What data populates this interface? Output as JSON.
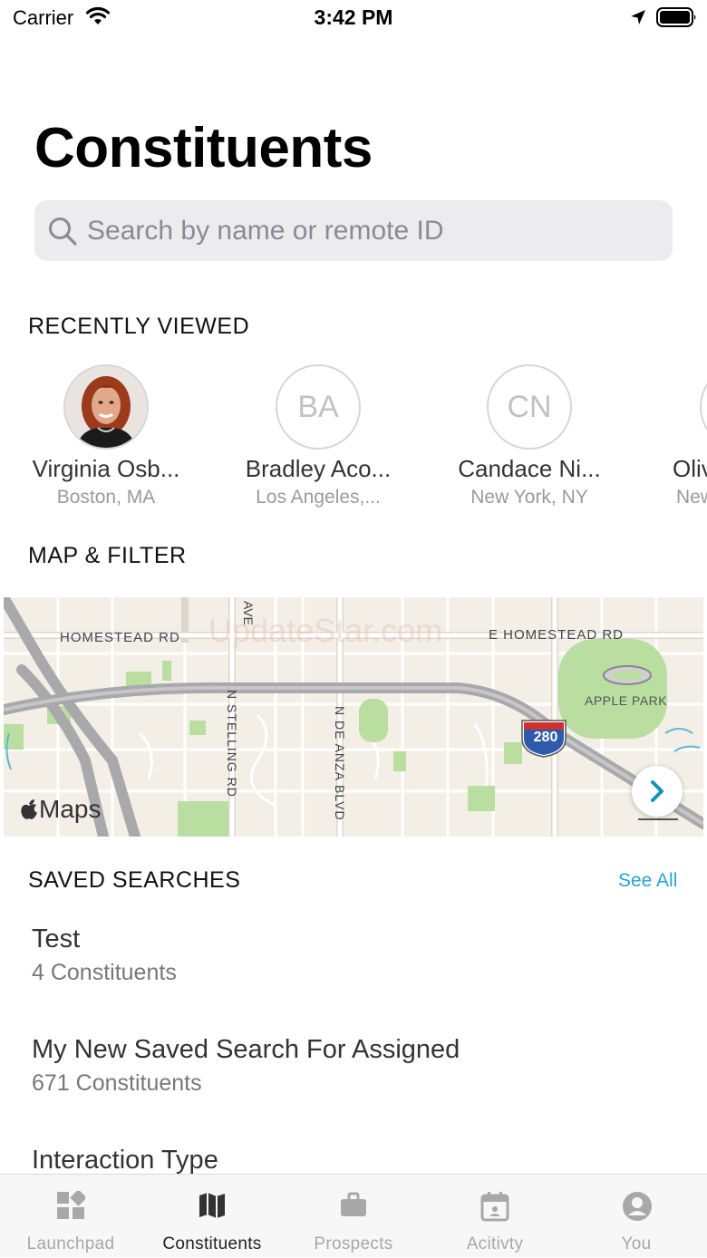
{
  "status_bar": {
    "carrier": "Carrier",
    "time": "3:42 PM",
    "icons": [
      "wifi-icon",
      "location-arrow-icon",
      "battery-icon"
    ]
  },
  "page": {
    "title": "Constituents"
  },
  "search": {
    "placeholder": "Search by name or remote ID",
    "value": "",
    "icon": "search-icon"
  },
  "recently_viewed": {
    "header": "RECENTLY VIEWED",
    "items": [
      {
        "initials": "",
        "name": "Virginia Osb...",
        "location": "Boston, MA",
        "has_photo": true
      },
      {
        "initials": "BA",
        "name": "Bradley Aco...",
        "location": "Los Angeles,..."
      },
      {
        "initials": "CN",
        "name": "Candace Ni...",
        "location": "New York, NY"
      },
      {
        "initials": "",
        "name": "Oliv",
        "location": "New"
      }
    ]
  },
  "map_filter": {
    "header": "MAP & FILTER",
    "labels": {
      "homestead_rd": "HOMESTEAD RD",
      "e_homestead_rd": "E HOMESTEAD RD",
      "ave": "AVE",
      "n_stelling_rd": "N STELLING RD",
      "n_de_anza_blvd": "N DE ANZA BLVD",
      "apple_park": "APPLE PARK",
      "interstate": "280",
      "brand": "Maps",
      "watermark": "UpdateStar.com"
    },
    "colors": {
      "land": "#f3efe6",
      "park": "#b9dea0",
      "highway": "#a9a9ab",
      "water": "#5fb6d9"
    }
  },
  "saved_searches": {
    "header": "SAVED SEARCHES",
    "see_all": "See All",
    "items": [
      {
        "title": "Test",
        "count": "4 Constituents"
      },
      {
        "title": "My New Saved Search For Assigned",
        "count": "671 Constituents"
      },
      {
        "title": "Interaction Type",
        "count": ""
      }
    ]
  },
  "tab_bar": {
    "tabs": [
      {
        "label": "Launchpad",
        "icon": "launchpad-grid-icon",
        "active": false
      },
      {
        "label": "Constituents",
        "icon": "map-icon",
        "active": true
      },
      {
        "label": "Prospects",
        "icon": "briefcase-icon",
        "active": false
      },
      {
        "label": "Acitivty",
        "icon": "calendar-icon",
        "active": false
      },
      {
        "label": "You",
        "icon": "person-icon",
        "active": false
      }
    ]
  },
  "colors": {
    "accent": "#2aa3d6",
    "active_tab": "#222222",
    "inactive_tab": "#a8a8a8"
  }
}
